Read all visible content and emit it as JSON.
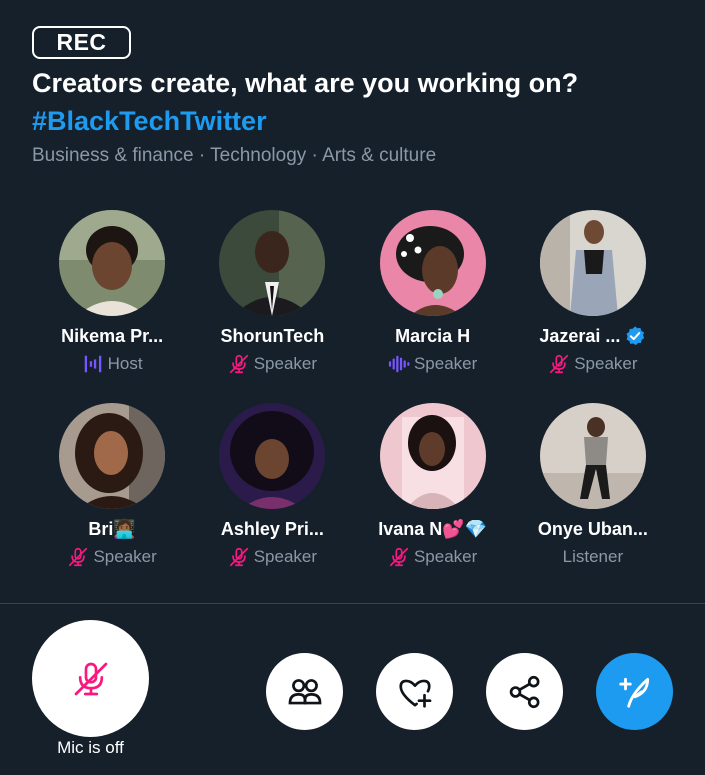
{
  "space": {
    "rec_label": "REC",
    "title": "Creators create, what are you working on?",
    "hashtag": "#BlackTechTwitter",
    "topics": "Business & finance · Technology · Arts & culture"
  },
  "participants": [
    {
      "name": "Nikema Pr...",
      "role": "Host",
      "role_icon": "host-waveform-icon",
      "verified": false
    },
    {
      "name": "ShorunTech",
      "role": "Speaker",
      "role_icon": "mic-muted-icon",
      "verified": false
    },
    {
      "name": "Marcia H",
      "role": "Speaker",
      "role_icon": "speaking-waveform-icon",
      "verified": false
    },
    {
      "name": "Jazerai ...",
      "role": "Speaker",
      "role_icon": "mic-muted-icon",
      "verified": true
    },
    {
      "name": "Bri👩🏾‍💻",
      "role": "Speaker",
      "role_icon": "mic-muted-icon",
      "verified": false
    },
    {
      "name": "Ashley Pri...",
      "role": "Speaker",
      "role_icon": "mic-muted-icon",
      "verified": false
    },
    {
      "name": "Ivana N💕💎",
      "role": "Speaker",
      "role_icon": "mic-muted-icon",
      "verified": false
    },
    {
      "name": "Onye Uban...",
      "role": "Listener",
      "role_icon": "",
      "verified": false
    }
  ],
  "controls": {
    "mic_label": "Mic is off",
    "mic_icon": "mic-off-icon",
    "people_icon": "people-icon",
    "react_icon": "heart-plus-icon",
    "share_icon": "share-icon",
    "tweet_icon": "compose-tweet-icon"
  },
  "colors": {
    "background": "#15202b",
    "accent": "#1d9bf0",
    "muted_text": "#8b98a5",
    "mic_off": "#f91880",
    "host_purple": "#7856ff"
  }
}
